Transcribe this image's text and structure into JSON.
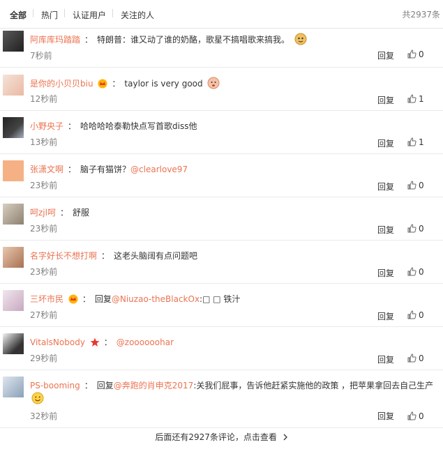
{
  "tabs": [
    "全部",
    "热门",
    "认证用户",
    "关注的人"
  ],
  "total": "共2937条",
  "reply_label": "回复",
  "comments": [
    {
      "user": "阿库库玛踏踏",
      "pre": "特朗普：谁又动了谁的奶酪，歌星不搞唱歌来搞我。",
      "at": "",
      "post": "",
      "time": "7秒前",
      "likes": "0"
    },
    {
      "user": "是你的小贝贝biu",
      "pre": "taylor is very good",
      "at": "",
      "post": "",
      "time": "12秒前",
      "likes": "1"
    },
    {
      "user": "小野央子",
      "pre": "哈哈哈哈泰勒快点写首歌diss他",
      "at": "",
      "post": "",
      "time": "13秒前",
      "likes": "1"
    },
    {
      "user": "张潇文啊",
      "pre": "脑子有猫饼？",
      "at": "@clearlove97",
      "post": "",
      "time": "23秒前",
      "likes": "0"
    },
    {
      "user": "呵zjl呵",
      "pre": "舒服",
      "at": "",
      "post": "",
      "time": "23秒前",
      "likes": "0"
    },
    {
      "user": "名字好长不想打啊",
      "pre": "这老头脑阔有点问题吧",
      "at": "",
      "post": "",
      "time": "23秒前",
      "likes": "0"
    },
    {
      "user": "三坏市民",
      "pre": "回复",
      "at": "@Niuzao-theBlackOx",
      "post": ":□ □ 铁汁",
      "time": "27秒前",
      "likes": "0"
    },
    {
      "user": "VitalsNobody",
      "pre": "",
      "at": "@zoooooohar",
      "post": "",
      "time": "29秒前",
      "likes": "0"
    },
    {
      "user": "PS-booming",
      "pre": "回复",
      "at": "@奔跑的肖申克2017",
      "post": ":关我们屁事，告诉他赶紧实施他的政策 ，把苹果拿回去自己生产",
      "time": "32秒前",
      "likes": "0"
    }
  ],
  "more_text": "后面还有2927条评论，点击查看",
  "colors": {
    "accent": "#eb7350",
    "text": "#333333",
    "muted": "#808080"
  },
  "icons": [
    "thumbs-up-icon",
    "chevron-right-icon",
    "doge-emoji-icon",
    "smile-emoji-icon",
    "crown-badge-icon",
    "red-star-badge-icon"
  ]
}
